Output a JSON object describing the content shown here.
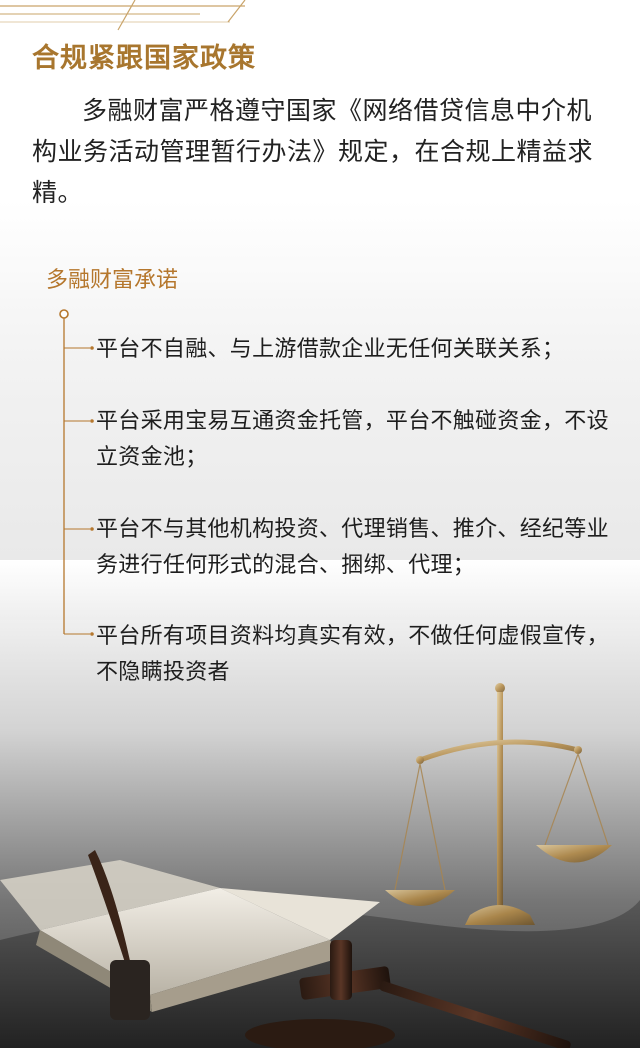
{
  "compliance": {
    "title": "合规紧跟国家政策",
    "intro": "多融财富严格遵守国家《网络借贷信息中介机构业务活动管理暂行办法》规定，在合规上精益求精。"
  },
  "commitments": {
    "heading": "多融财富承诺",
    "items": [
      "平台不自融、与上游借款企业无任何关联关系；",
      "平台采用宝易互通资金托管，平台不触碰资金，不设立资金池；",
      "平台不与其他机构投资、代理销售、推介、经纪等业务进行任何形式的混合、捆绑、代理；",
      "平台所有项目资料均真实有效，不做任何虚假宣传，不隐瞒投资者"
    ]
  },
  "colors": {
    "accent": "#b5772d",
    "text": "#222222"
  },
  "icons": [
    "scales-of-justice-icon",
    "gavel-icon",
    "open-book-icon",
    "quill-pen-icon"
  ]
}
